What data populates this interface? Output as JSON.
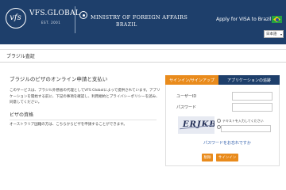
{
  "header": {
    "brand": "VFS.GLOBAL",
    "brand_sub": "EST. 2001",
    "ministry": "MINISTRY OF FOREIGN AFFAIRS",
    "ministry_sub": "BRAZIL",
    "apply_text": "Apply for VISA to Brazil",
    "language": "日本語",
    "header_color": "#1e3f6b"
  },
  "page": {
    "title": "ブラジル査証"
  },
  "main": {
    "heading": "ブラジルのビザのオンライン申請と支払い",
    "intro": "このサービスは、ブラジル外務省の代理としてVFS Globalによって提供されています。アプリケーションを開始する前に、下記の事項を確認し、利用規約とプライバシーポリシーを読み、同意してください。",
    "visa_heading": "ビザの資格",
    "australia_text": "オーストラリア国籍の方は、こちらからビザを申請することができます。"
  },
  "login": {
    "tab_signin": "サインイン/サインアップ",
    "tab_status": "アプリケーションの追跡",
    "user_id_label": "ユーザーID",
    "password_label": "パスワード",
    "captcha_text": "ERJKB",
    "captcha_hint": "テキストを入力してください",
    "forgot_password": "パスワードをお忘れですか",
    "clear_button": "削除",
    "signin_button": "サインイン",
    "accent_color": "#e98b1c"
  }
}
